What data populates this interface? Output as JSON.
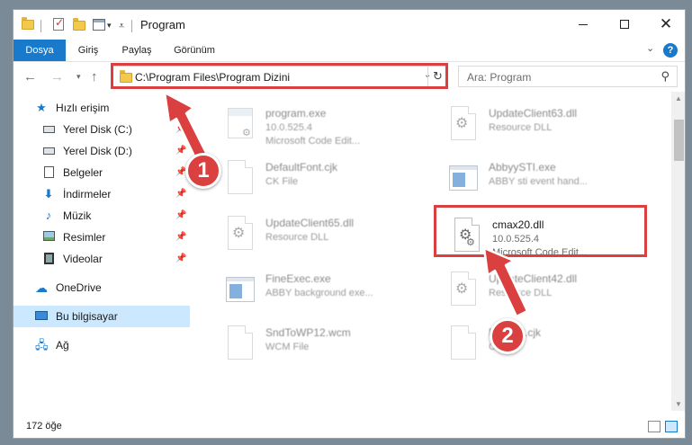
{
  "window": {
    "title": "Program"
  },
  "ribbon": {
    "tabs": [
      "Dosya",
      "Giriş",
      "Paylaş",
      "Görünüm"
    ],
    "help": "?"
  },
  "address": {
    "path": "C:\\Program Files\\Program Dizini"
  },
  "search": {
    "placeholder": "Ara: Program"
  },
  "sidebar": {
    "items": [
      {
        "label": "Hızlı erişim",
        "icon": "star-icon"
      },
      {
        "label": "Yerel Disk (C:)",
        "icon": "drive-icon"
      },
      {
        "label": "Yerel Disk (D:)",
        "icon": "drive-icon"
      },
      {
        "label": "Belgeler",
        "icon": "documents-icon"
      },
      {
        "label": "İndirmeler",
        "icon": "download-icon"
      },
      {
        "label": "Müzik",
        "icon": "music-icon"
      },
      {
        "label": "Resimler",
        "icon": "pictures-icon"
      },
      {
        "label": "Videolar",
        "icon": "video-icon"
      },
      {
        "label": "OneDrive",
        "icon": "cloud-icon"
      },
      {
        "label": "Bu bilgisayar",
        "icon": "computer-icon"
      },
      {
        "label": "Ağ",
        "icon": "network-icon"
      }
    ]
  },
  "files": [
    {
      "name": "program.exe",
      "line2": "10.0.525.4",
      "line3": "Microsoft Code Edit..."
    },
    {
      "name": "UpdateClient63.dll",
      "line2": "Resource DLL",
      "line3": ""
    },
    {
      "name": "DefaultFont.cjk",
      "line2": "CK File",
      "line3": ""
    },
    {
      "name": "AbbyySTI.exe",
      "line2": "ABBY sti event hand...",
      "line3": ""
    },
    {
      "name": "UpdateClient65.dll",
      "line2": "Resource DLL",
      "line3": ""
    },
    {
      "name": "cmax20.dll",
      "line2": "10.0.525.4",
      "line3": "Microsoft Code Edit..."
    },
    {
      "name": "FineExec.exe",
      "line2": "ABBY background exe...",
      "line3": ""
    },
    {
      "name": "UpdateClient42.dll",
      "line2": "Resource DLL",
      "line3": ""
    },
    {
      "name": "SndToWP12.wcm",
      "line2": "WCM File",
      "line3": ""
    },
    {
      "name": "Fe...nel.cjk",
      "line2": "CJ...",
      "line3": ""
    }
  ],
  "status": {
    "count": "172 öğe"
  },
  "annotations": {
    "callout1": "1",
    "callout2": "2"
  },
  "colors": {
    "accent": "#1979ca",
    "highlight": "#d9403f",
    "selected": "#cce8ff"
  }
}
